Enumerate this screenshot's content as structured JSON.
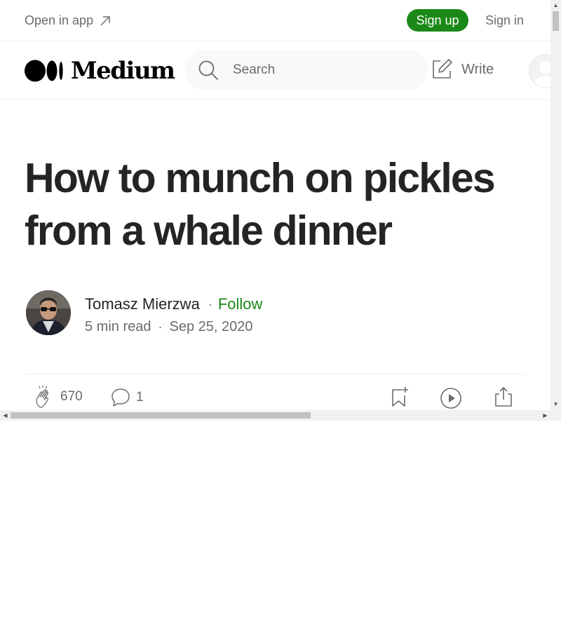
{
  "topbar": {
    "open_in_app": "Open in app",
    "sign_up": "Sign up",
    "sign_in": "Sign in"
  },
  "navbar": {
    "logo_text": "Medium",
    "search_placeholder": "Search",
    "write_label": "Write"
  },
  "article": {
    "title": "How to munch on pickles from a whale dinner",
    "author": "Tomasz Mierzwa",
    "follow_label": "Follow",
    "read_time": "5 min read",
    "date": "Sep 25, 2020",
    "separator": "·"
  },
  "actions": {
    "claps": "670",
    "responses": "1"
  },
  "colors": {
    "accent_green": "#1a8917",
    "text_primary": "#242424",
    "text_secondary": "#6b6b6b",
    "search_bg": "#f9f9f9"
  },
  "icons": {
    "open_app": "arrow-up-right-icon",
    "search": "search-icon",
    "write": "write-icon",
    "clap": "clap-icon",
    "response": "comment-icon",
    "save": "bookmark-add-icon",
    "listen": "play-icon",
    "share": "share-icon"
  }
}
